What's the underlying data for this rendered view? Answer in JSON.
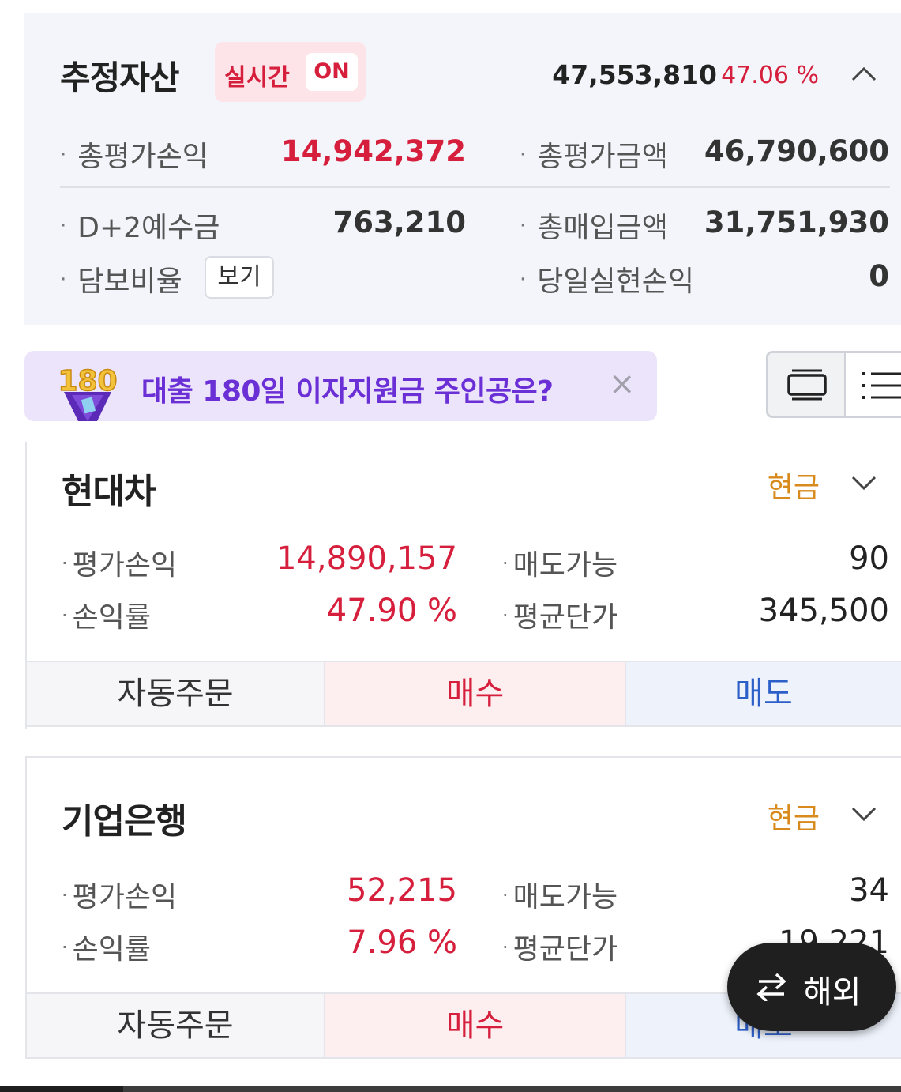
{
  "summary": {
    "title": "추정자산",
    "realtime_label": "실시간",
    "realtime_state": "ON",
    "total": "47,553,810",
    "rate": "47.06 %",
    "rows": {
      "eval_pl_label": "총평가손익",
      "eval_pl_value": "14,942,372",
      "eval_amount_label": "총평가금액",
      "eval_amount_value": "46,790,600",
      "deposit_label": "D+2예수금",
      "deposit_value": "763,210",
      "purchase_label": "총매입금액",
      "purchase_value": "31,751,930",
      "collateral_label": "담보비율",
      "collateral_button": "보기",
      "realized_label": "당일실현손익",
      "realized_value": "0"
    }
  },
  "banner": {
    "badge": "180",
    "text": "대출 180일 이자지원금 주인공은?",
    "close": "×"
  },
  "holdings": [
    {
      "name": "현대차",
      "account_type": "현금",
      "pl_label": "평가손익",
      "pl_value": "14,890,157",
      "sellable_label": "매도가능",
      "sellable_value": "90",
      "rate_label": "손익률",
      "rate_value": "47.90 %",
      "avg_label": "평균단가",
      "avg_value": "345,500",
      "btn_auto": "자동주문",
      "btn_buy": "매수",
      "btn_sell": "매도"
    },
    {
      "name": "기업은행",
      "account_type": "현금",
      "pl_label": "평가손익",
      "pl_value": "52,215",
      "sellable_label": "매도가능",
      "sellable_value": "34",
      "rate_label": "손익률",
      "rate_value": "7.96 %",
      "avg_label": "평균단가",
      "avg_value": "19,221",
      "btn_auto": "자동주문",
      "btn_buy": "매수",
      "btn_sell": "매도"
    }
  ],
  "fab": {
    "label": "해외",
    "icon": "swap-arrows-icon"
  },
  "colors": {
    "positive": "#d61f3c",
    "sell": "#2d5fc9",
    "account_type": "#d98a1c",
    "banner_bg": "#ece4fb",
    "banner_text": "#6b2fd6"
  }
}
